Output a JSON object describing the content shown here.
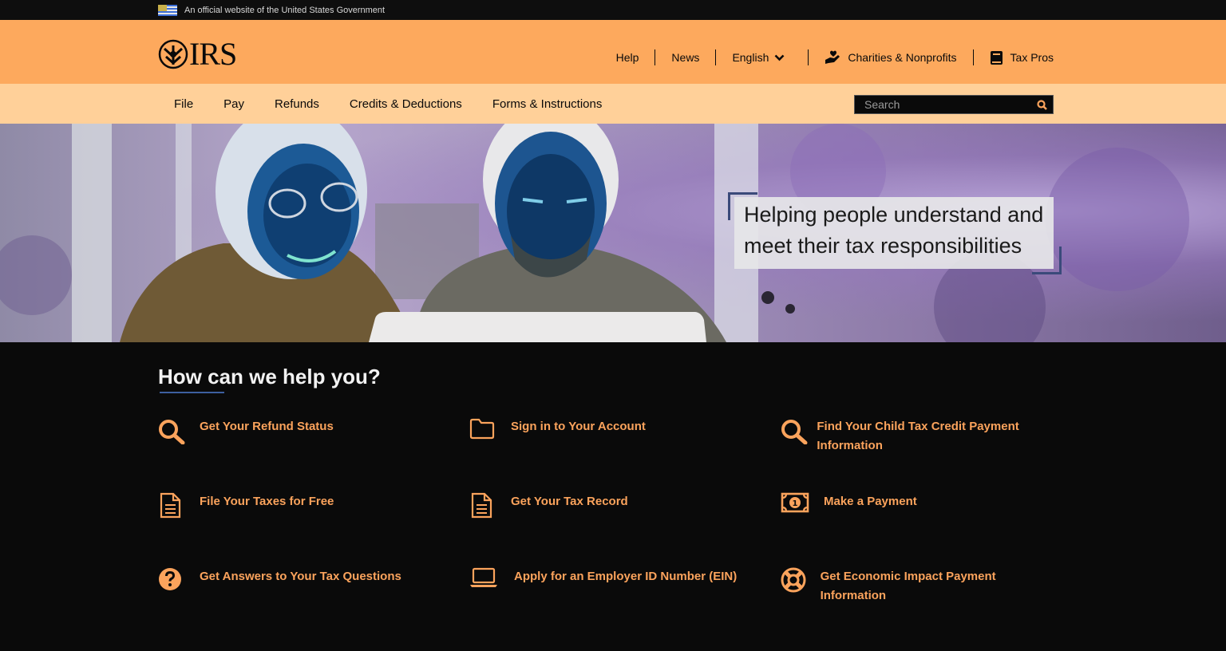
{
  "gov_banner": {
    "text": "An official website of the United States Government"
  },
  "logo": {
    "text": "IRS"
  },
  "util_nav": {
    "help": "Help",
    "news": "News",
    "language": "English",
    "charities": "Charities & Nonprofits",
    "tax_pros": "Tax Pros"
  },
  "main_nav": [
    "File",
    "Pay",
    "Refunds",
    "Credits & Deductions",
    "Forms & Instructions"
  ],
  "search": {
    "placeholder": "Search"
  },
  "hero": {
    "line1": "Helping people understand and",
    "line2": "meet their tax responsibilities"
  },
  "help": {
    "title": "How can we help you?",
    "links": [
      {
        "label": "Get Your Refund Status",
        "icon": "search-icon"
      },
      {
        "label": "Sign in to Your Account",
        "icon": "folder-icon"
      },
      {
        "label": "Find Your Child Tax Credit Payment Information",
        "icon": "search-icon"
      },
      {
        "label": "File Your Taxes for Free",
        "icon": "document-icon"
      },
      {
        "label": "Get Your Tax Record",
        "icon": "document-icon"
      },
      {
        "label": "Make a Payment",
        "icon": "money-bill-icon"
      },
      {
        "label": "Get Answers to Your Tax Questions",
        "icon": "question-circle-icon"
      },
      {
        "label": "Apply for an Employer ID Number (EIN)",
        "icon": "laptop-icon"
      },
      {
        "label": "Get Economic Impact Payment Information",
        "icon": "life-ring-icon"
      }
    ]
  },
  "colors": {
    "header_bg": "#fda95d",
    "nav_bg": "#ffd099",
    "link_orange": "#fba35c",
    "page_bg": "#0a0a0a"
  }
}
